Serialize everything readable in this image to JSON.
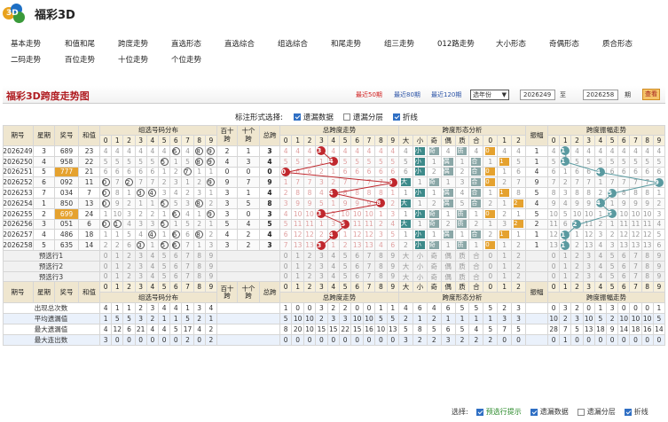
{
  "site": {
    "title": "福彩3D",
    "logo_text": "3D"
  },
  "nav": [
    [
      "基本走势",
      12,
      43
    ],
    [
      "和值和尾",
      73,
      43
    ],
    [
      "跨度走势",
      133,
      43
    ],
    [
      "直选形态",
      193,
      43
    ],
    [
      "直选综合",
      253,
      43
    ],
    [
      "组选综合",
      313,
      43
    ],
    [
      "和尾走势",
      373,
      43
    ],
    [
      "组三走势",
      433,
      43
    ],
    [
      "012路走势",
      493,
      43
    ],
    [
      "大小形态",
      559,
      43
    ],
    [
      "奇偶形态",
      619,
      43
    ],
    [
      "质合形态",
      679,
      43
    ],
    [
      "二码走势",
      12,
      61
    ],
    [
      "百位走势",
      73,
      61
    ],
    [
      "十位走势",
      133,
      61
    ],
    [
      "个位走势",
      193,
      61
    ]
  ],
  "panel": {
    "title": "福彩3D跨度走势图",
    "recent": [
      "最近50期",
      "最近80期",
      "最近120期"
    ],
    "select_label": "选年份",
    "from_issue": "2026249",
    "to_label": "至",
    "to_issue": "2026258",
    "period_label": "期",
    "query": "查看"
  },
  "options": {
    "label": "标注形式选择:",
    "items": [
      [
        "遗漏数据",
        true
      ],
      [
        "遗漏分层",
        false
      ],
      [
        "折线",
        true
      ]
    ]
  },
  "header": {
    "issue": "期号",
    "week": "星期",
    "draw": "奖号",
    "sum": "和值",
    "group_dist": "组选号码分布",
    "bai_shi": "百十跨",
    "shi_ge": "十个跨",
    "span_total": "总跨",
    "span_trend": "总跨度走势",
    "span_form": "跨度形态分析",
    "amp": "振幅",
    "amp_trend": "跨度振幅走势",
    "form_cols": [
      "大",
      "小",
      "奇",
      "偶",
      "质",
      "合",
      "0",
      "1",
      "2"
    ]
  },
  "rows": [
    {
      "issue": "2026249",
      "week": "3",
      "num": "689",
      "sum": "23",
      "bs": "2",
      "sg": "1",
      "span": "3",
      "amp": "1"
    },
    {
      "issue": "2026250",
      "week": "4",
      "num": "958",
      "sum": "22",
      "bs": "4",
      "sg": "3",
      "span": "4",
      "amp": "1"
    },
    {
      "issue": "2026251",
      "week": "5",
      "num": "777",
      "sum": "21",
      "bs": "0",
      "sg": "0",
      "span": "0",
      "amp": "4"
    },
    {
      "issue": "2026252",
      "week": "6",
      "num": "092",
      "sum": "11",
      "bs": "9",
      "sg": "7",
      "span": "9",
      "amp": "9"
    },
    {
      "issue": "2026253",
      "week": "7",
      "num": "034",
      "sum": "7",
      "bs": "3",
      "sg": "1",
      "span": "4",
      "amp": "5"
    },
    {
      "issue": "2026254",
      "week": "1",
      "num": "850",
      "sum": "13",
      "bs": "3",
      "sg": "5",
      "span": "8",
      "amp": "4"
    },
    {
      "issue": "2026255",
      "week": "2",
      "num": "699",
      "sum": "24",
      "bs": "3",
      "sg": "0",
      "span": "3",
      "amp": "5"
    },
    {
      "issue": "2026256",
      "week": "3",
      "num": "051",
      "sum": "6",
      "bs": "5",
      "sg": "4",
      "span": "5",
      "amp": "2"
    },
    {
      "issue": "2026257",
      "week": "4",
      "num": "486",
      "sum": "18",
      "bs": "4",
      "sg": "2",
      "span": "4",
      "amp": "1"
    },
    {
      "issue": "2026258",
      "week": "5",
      "num": "635",
      "sum": "14",
      "bs": "3",
      "sg": "2",
      "span": "3",
      "amp": "1"
    }
  ],
  "predict": [
    "预选行1",
    "预选行2",
    "预选行3"
  ],
  "stats": {
    "labels": [
      "出现总次数",
      "平均遗漏值",
      "最大遗漏值",
      "最大连出数"
    ],
    "group": [
      [
        "4",
        "1",
        "1",
        "2",
        "3",
        "4",
        "4",
        "1",
        "3",
        "4"
      ],
      [
        "1",
        "5",
        "5",
        "3",
        "2",
        "1",
        "1",
        "5",
        "2",
        "1"
      ],
      [
        "4",
        "12",
        "6",
        "21",
        "4",
        "4",
        "5",
        "17",
        "4",
        "2"
      ],
      [
        "3",
        "0",
        "0",
        "0",
        "0",
        "0",
        "0",
        "2",
        "0",
        "2"
      ]
    ],
    "span": [
      [
        "1",
        "0",
        "0",
        "3",
        "2",
        "2",
        "0",
        "0",
        "1",
        "1"
      ],
      [
        "5",
        "10",
        "10",
        "2",
        "3",
        "3",
        "10",
        "10",
        "5",
        "5"
      ],
      [
        "8",
        "20",
        "10",
        "15",
        "15",
        "22",
        "15",
        "16",
        "10",
        "13"
      ],
      [
        "0",
        "0",
        "0",
        "0",
        "0",
        "0",
        "0",
        "0",
        "0",
        "0"
      ]
    ],
    "form": [
      [
        "4",
        "6",
        "4",
        "6",
        "5",
        "5",
        "5",
        "2",
        "3"
      ],
      [
        "2",
        "1",
        "2",
        "1",
        "1",
        "1",
        "1",
        "3",
        "3"
      ],
      [
        "5",
        "8",
        "5",
        "6",
        "5",
        "4",
        "5",
        "7",
        "5"
      ],
      [
        "3",
        "2",
        "2",
        "3",
        "2",
        "2",
        "2",
        "0",
        "0"
      ]
    ],
    "amp": [
      [
        "0",
        "3",
        "2",
        "0",
        "1",
        "3",
        "0",
        "0",
        "0",
        "1"
      ],
      [
        "10",
        "2",
        "3",
        "10",
        "5",
        "2",
        "10",
        "10",
        "10",
        "5"
      ],
      [
        "28",
        "7",
        "5",
        "13",
        "18",
        "9",
        "14",
        "18",
        "16",
        "14"
      ],
      [
        "0",
        "1",
        "0",
        "0",
        "0",
        "0",
        "0",
        "0",
        "0",
        "0"
      ]
    ]
  },
  "footer": {
    "label": "选择:",
    "items": [
      [
        "预选行提示",
        true
      ],
      [
        "遗漏数据",
        true
      ],
      [
        "遗漏分层",
        false
      ],
      [
        "折线",
        true
      ]
    ]
  },
  "colors": {
    "accent": "#b01d22",
    "ball": "#c0272d",
    "amp_ball": "#5a9aa0",
    "form_big": "#3d8a8a"
  }
}
